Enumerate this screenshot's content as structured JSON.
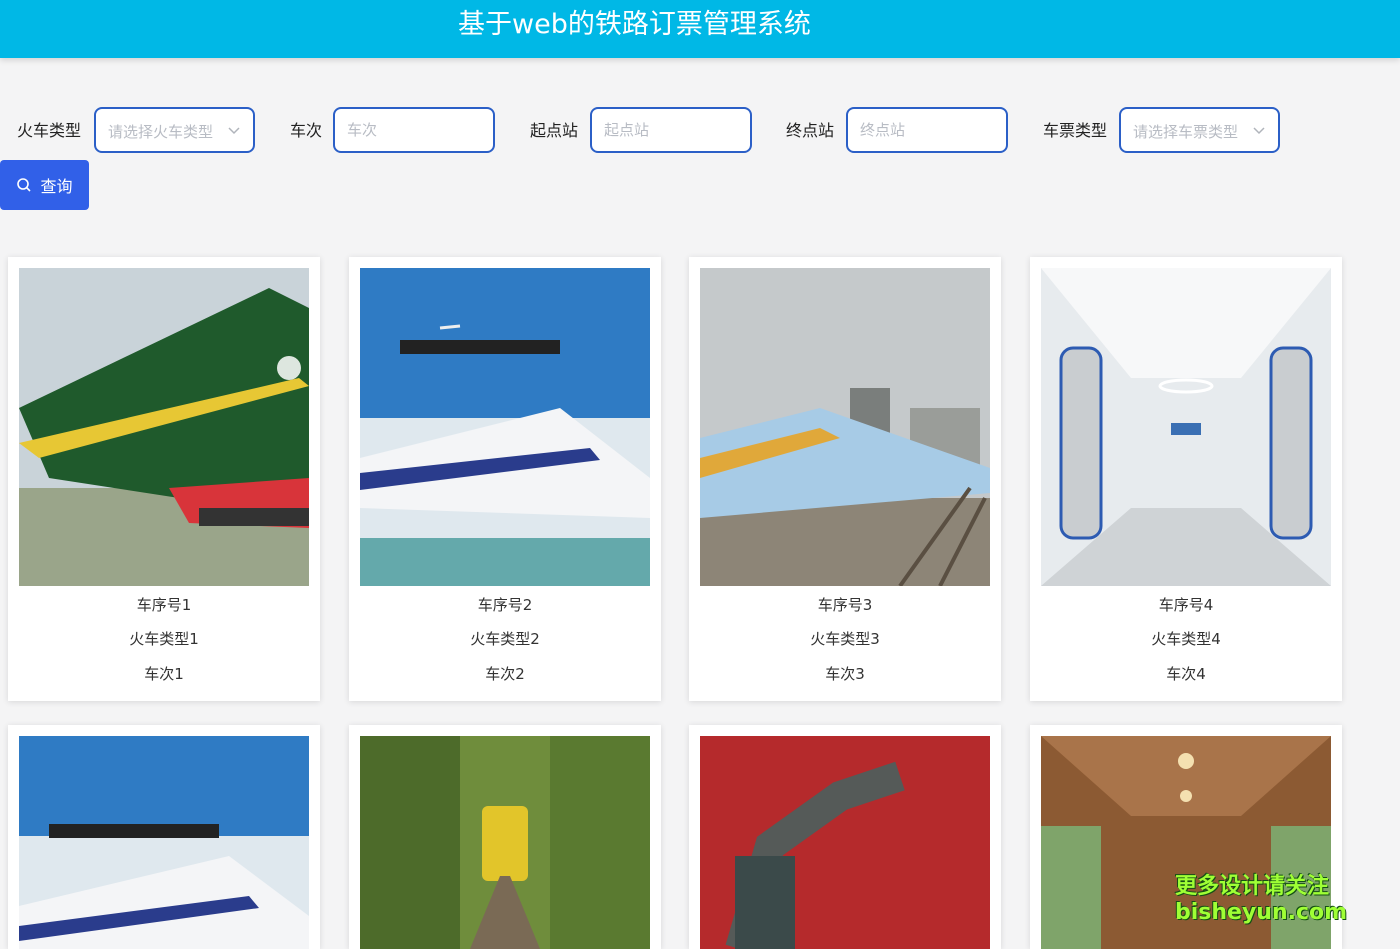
{
  "header": {
    "title": "基于web的铁路订票管理系统"
  },
  "filters": {
    "train_type": {
      "label": "火车类型",
      "placeholder": "请选择火车类型"
    },
    "train_no": {
      "label": "车次",
      "placeholder": "车次"
    },
    "start": {
      "label": "起点站",
      "placeholder": "起点站"
    },
    "end": {
      "label": "终点站",
      "placeholder": "终点站"
    },
    "ticket_type": {
      "label": "车票类型",
      "placeholder": "请选择车票类型"
    },
    "search_label": "查询"
  },
  "cards": [
    {
      "seq": "车序号1",
      "type": "火车类型1",
      "no": "车次1"
    },
    {
      "seq": "车序号2",
      "type": "火车类型2",
      "no": "车次2"
    },
    {
      "seq": "车序号3",
      "type": "火车类型3",
      "no": "车次3"
    },
    {
      "seq": "车序号4",
      "type": "火车类型4",
      "no": "车次4"
    }
  ],
  "watermark": {
    "line1": "更多设计请关注",
    "line2": "bisheyun.com"
  },
  "colors": {
    "header": "#00b8e6",
    "accent": "#3160e8",
    "border": "#2b5fc7"
  }
}
